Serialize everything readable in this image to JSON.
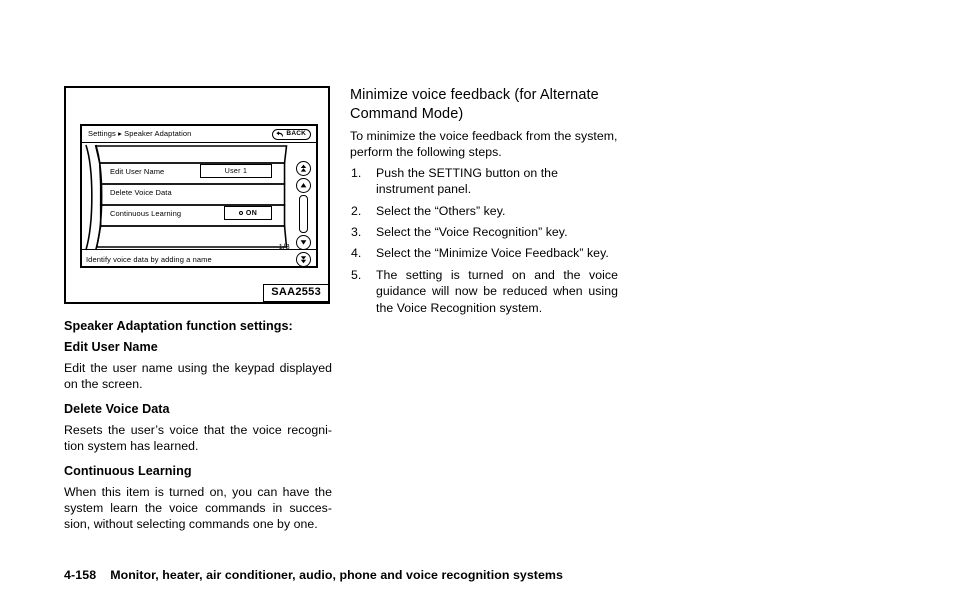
{
  "figure": {
    "caption": "SAA2553",
    "screen": {
      "title": "Settings ▸ Speaker Adaptation",
      "back_button_label": "BACK",
      "rows": [
        {
          "label": "Edit User Name",
          "value": "User 1",
          "control": "value-box"
        },
        {
          "label": "Delete Voice Data",
          "value": "",
          "control": "none"
        },
        {
          "label": "Continuous Learning",
          "value": "ON",
          "control": "toggle"
        }
      ],
      "page_indicator": "1/3",
      "status_text": "Identify voice data by adding a name",
      "scroll_buttons": [
        "page-up-icon",
        "scroll-up-icon",
        "scroll-down-icon",
        "page-down-icon"
      ]
    }
  },
  "left_column": {
    "heading": "Speaker Adaptation function settings:",
    "sections": [
      {
        "heading": "Edit User Name",
        "body": "Edit the user name using the keypad displayed on the screen."
      },
      {
        "heading": "Delete Voice Data",
        "body": "Resets the user’s voice that the voice recogni­tion system has learned."
      },
      {
        "heading": "Continuous Learning",
        "body": "When this item is turned on, you can have the system learn the voice commands in succes­sion, without selecting commands one by one."
      }
    ]
  },
  "right_column": {
    "heading": "Minimize voice feedback (for Alternate Command Mode)",
    "intro": "To minimize the voice feedback from the system, perform the following steps.",
    "steps": [
      {
        "num": "1.",
        "text": "Push the SETTING button on the instrument panel."
      },
      {
        "num": "2.",
        "text": "Select the “Others” key."
      },
      {
        "num": "3.",
        "text": "Select the “Voice Recognition” key."
      },
      {
        "num": "4.",
        "text": "Select the “Minimize Voice Feedback” key."
      },
      {
        "num": "5.",
        "text": "The setting is turned on and the voice guidance will now be reduced when using the Voice Recognition system."
      }
    ]
  },
  "footer": {
    "page_number": "4-158",
    "title": "Monitor, heater, air conditioner, audio, phone and voice recognition systems"
  }
}
